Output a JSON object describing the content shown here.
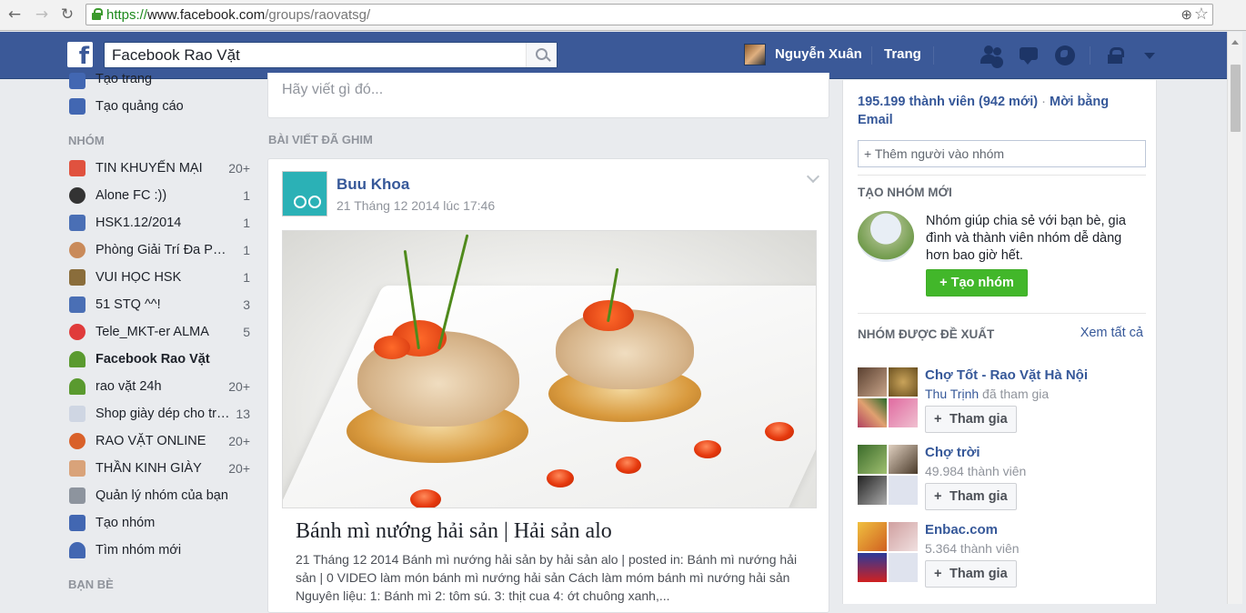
{
  "browser": {
    "url_scheme": "https://",
    "url_domain": "www.facebook.com",
    "url_path": "/groups/raovatsg/"
  },
  "topbar": {
    "search_value": "Facebook Rao Vặt",
    "user_name": "Nguyễn Xuân",
    "home_label": "Trang"
  },
  "sidebar": {
    "top_items": [
      {
        "label": "Tạo trang",
        "icon": "plus-square-icon"
      },
      {
        "label": "Tạo quảng cáo",
        "icon": "chart-icon"
      }
    ],
    "groups_header": "NHÓM",
    "groups": [
      {
        "label": "TIN KHUYẾN MẠI",
        "count": "20+",
        "icon": "gift-icon"
      },
      {
        "label": "Alone FC :))",
        "count": "1",
        "icon": "soccer-ball-icon"
      },
      {
        "label": "HSK1.12/2014",
        "count": "1",
        "icon": "group-icon"
      },
      {
        "label": "Phòng Giải Trí Đa Phương Tiện",
        "count": "1",
        "icon": "head-icon"
      },
      {
        "label": "VUI HỌC HSK",
        "count": "1",
        "icon": "book-icon"
      },
      {
        "label": "51 STQ ^^!",
        "count": "3",
        "icon": "group-icon"
      },
      {
        "label": "Tele_MKT-er ALMA",
        "count": "5",
        "icon": "apple-icon"
      },
      {
        "label": "Facebook Rao Vặt",
        "count": "",
        "icon": "plant-icon"
      },
      {
        "label": "rao vặt 24h",
        "count": "20+",
        "icon": "plant-icon"
      },
      {
        "label": "Shop giày dép cho trẻ em",
        "count": "13",
        "icon": "shoe-icon"
      },
      {
        "label": "RAO VẶT ONLINE",
        "count": "20+",
        "icon": "basketball-icon"
      },
      {
        "label": "THẦN KINH GIÀY",
        "count": "20+",
        "icon": "shoe-icon"
      },
      {
        "label": "Quản lý nhóm của bạn",
        "count": "",
        "icon": "list-icon"
      },
      {
        "label": "Tạo nhóm",
        "count": "",
        "icon": "plus-square-icon"
      },
      {
        "label": "Tìm nhóm mới",
        "count": "",
        "icon": "rocket-icon"
      }
    ],
    "friends_header": "BẠN BÈ"
  },
  "composer": {
    "placeholder": "Hãy viết gì đó..."
  },
  "pinned_header": "BÀI VIẾT ĐÃ GHIM",
  "post": {
    "author": "Buu Khoa",
    "time": "21 Tháng 12 2014 lúc 17:46",
    "link_title": "Bánh mì nướng hải sản | Hải sản alo",
    "link_desc": "21 Tháng 12 2014 Bánh mì nướng hải sản by hải sản alo | posted in: Bánh mì nướng hải sản | 0 VIDEO làm món bánh mì nướng hải sản Cách làm móm bánh mì nướng hải sản Nguyên liệu: 1: Bánh mì 2: tôm sú. 3: thịt cua 4: ớt chuông xanh,..."
  },
  "right": {
    "members_count": "195.199 thành viên",
    "members_new": "(942 mới)",
    "invite_email": "Mời bằng Email",
    "add_people_placeholder": "+ Thêm người vào nhóm",
    "create_header": "TẠO NHÓM MỚI",
    "create_text": "Nhóm giúp chia sẻ với bạn bè, gia đình và thành viên nhóm dễ dàng hơn bao giờ hết.",
    "create_button": "Tạo nhóm",
    "suggested_header": "NHÓM ĐƯỢC ĐỀ XUẤT",
    "see_all": "Xem tất cả",
    "join_label": "Tham gia",
    "suggestions": [
      {
        "name": "Chợ Tốt - Rao Vặt Hà Nội",
        "sub_name": "Thu Trịnh",
        "sub_text": " đã tham gia"
      },
      {
        "name": "Chợ trời",
        "sub_name": "",
        "sub_text": "49.984 thành viên"
      },
      {
        "name": "Enbac.com",
        "sub_name": "",
        "sub_text": "5.364 thành viên"
      }
    ]
  }
}
